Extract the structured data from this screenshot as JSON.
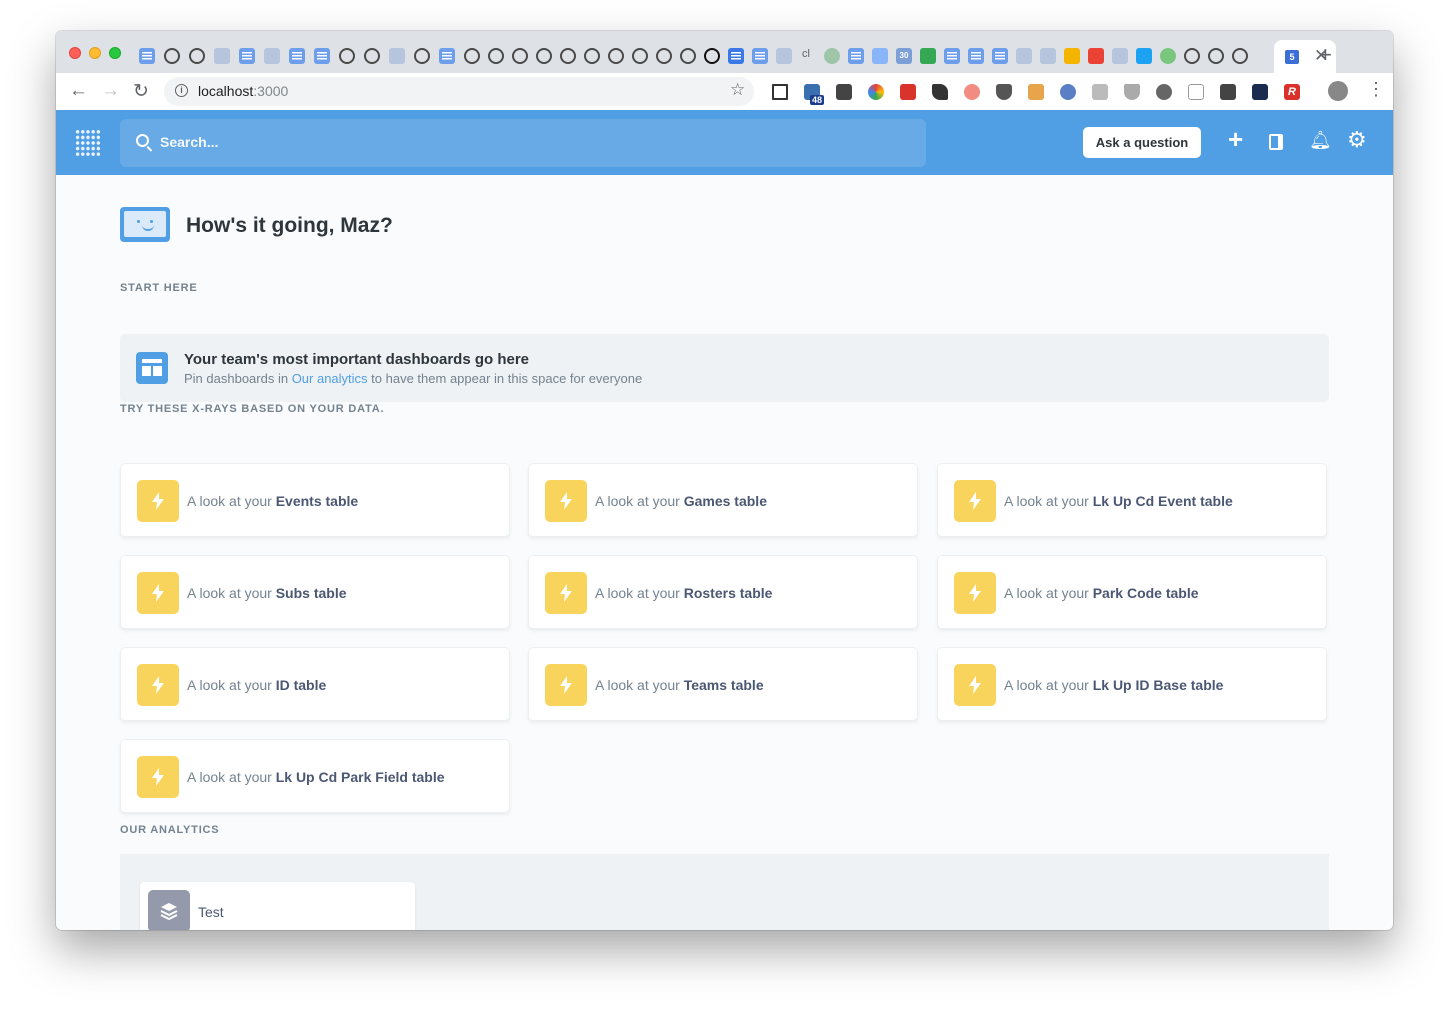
{
  "browser": {
    "url_host": "localhost",
    "url_port": ":3000",
    "active_tab_badge": "5",
    "extension_badge": "48",
    "pinned_tab_text": "cl",
    "pinned_tab_number": "30"
  },
  "header": {
    "search_placeholder": "Search...",
    "ask_button": "Ask a question"
  },
  "greeting": "How's it going, Maz?",
  "start_here": {
    "label": "START HERE",
    "title": "Your team's most important dashboards go here",
    "desc_prefix": "Pin dashboards in ",
    "desc_link": "Our analytics",
    "desc_suffix": " to have them appear in this space for everyone"
  },
  "xrays": {
    "label": "TRY THESE X-RAYS BASED ON YOUR DATA.",
    "prefix": "A look at your ",
    "items": [
      {
        "table": "Events table"
      },
      {
        "table": "Games table"
      },
      {
        "table": "Lk Up Cd Event table"
      },
      {
        "table": "Subs table"
      },
      {
        "table": "Rosters table"
      },
      {
        "table": "Park Code table"
      },
      {
        "table": "ID table"
      },
      {
        "table": "Teams table"
      },
      {
        "table": "Lk Up ID Base table"
      },
      {
        "table": "Lk Up Cd Park Field table"
      }
    ]
  },
  "our_analytics": {
    "label": "OUR ANALYTICS",
    "collections": [
      {
        "name": "Test"
      }
    ]
  },
  "colors": {
    "brand": "#509ee3",
    "xray_icon": "#f9d45c",
    "text_dark": "#2e353b",
    "text_medium": "#74838f"
  }
}
